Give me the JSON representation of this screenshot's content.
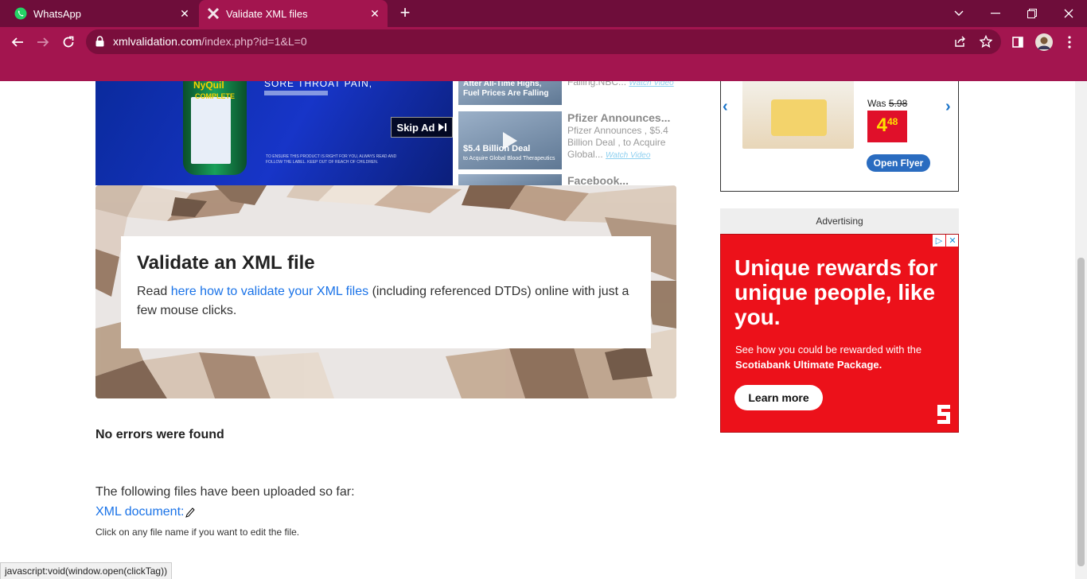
{
  "browser": {
    "tabs": [
      {
        "title": "WhatsApp"
      },
      {
        "title": "Validate XML files"
      }
    ],
    "url_host": "xmlvalidation.com",
    "url_path": "/index.php?id=1&L=0"
  },
  "video_ad": {
    "brand": "NyQuil",
    "subbrand": "COMPLETE",
    "headline": "SORE THROAT PAIN,",
    "skip_label": "Skip Ad",
    "fine_print": "TO ENSURE THIS PRODUCT IS RIGHT FOR YOU, ALWAYS READ AND FOLLOW THE LABEL. KEEP OUT OF REACH OF CHILDREN."
  },
  "news": [
    {
      "thumb_caption": "After All-Time Highs, Fuel Prices Are Falling",
      "body": "Falling.NBC...",
      "link": "Watch Video"
    },
    {
      "title": "Pfizer Announces...",
      "thumb_caption": "$5.4 Billion Deal",
      "thumb_sub": "to Acquire Global Blood Therapeutics",
      "body": "Pfizer Announces , $5.4 Billion Deal , to Acquire Global...",
      "link": "Watch Video"
    },
    {
      "title": "Facebook..."
    }
  ],
  "hero": {
    "title": "Validate an XML file",
    "text_before": "Read ",
    "link_text": "here how to validate your XML files",
    "text_after": " (including referenced DTDs) online with just a few mouse clicks."
  },
  "result": {
    "message": "No errors were found",
    "files_intro": "The following files have been uploaded so far:",
    "file_link": "XML document:",
    "hint": "Click on any file name if you want to edit the file."
  },
  "flyer_ad": {
    "was_label": "Was",
    "was_price": "5.98",
    "price_main": "4",
    "price_cents": "48",
    "button": "Open Flyer"
  },
  "advertising": {
    "label": "Advertising",
    "headline": "Unique rewards for unique people, like you.",
    "sub_before": "See how you could be rewarded with the ",
    "sub_bold": "Scotiabank Ultimate Package.",
    "button": "Learn more"
  },
  "status_bar": "javascript:void(window.open(clickTag))",
  "colors": {
    "tab_strip": "#6e0d3a",
    "toolbar": "#a3154f",
    "link": "#1a73e8",
    "scotia_red": "#ec111a"
  }
}
